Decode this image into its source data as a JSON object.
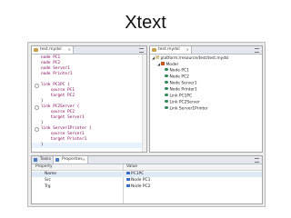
{
  "slide": {
    "title": "Xtext"
  },
  "editor": {
    "tab": "test.mydsl",
    "lines": [
      "node PC1",
      "node PC2",
      "node Server1",
      "node Printer1",
      "",
      "link PC1PC {",
      "    source PC1",
      "    target PC2",
      "}",
      "link PC2Server {",
      "    source PC2",
      "    target Server1",
      "}",
      "link Server1Printer {",
      "    source Server1",
      "    target Printer1",
      "}"
    ]
  },
  "outline": {
    "tab": "test.mydsl",
    "root": "platform:/resource/test/test.mydsl",
    "model": "Model",
    "items": [
      "Node PC1",
      "Node PC2",
      "Node Server1",
      "Node Printer1",
      "Link PC1PC",
      "Link PC2Server",
      "Link Server1Printer"
    ]
  },
  "properties": {
    "tabs": [
      "Tasks",
      "Properties"
    ],
    "columns": [
      "Property",
      "Value"
    ],
    "rows": [
      {
        "property": "Name",
        "value": "PC1PC"
      },
      {
        "property": "Src",
        "value": "Node PC1"
      },
      {
        "property": "Trg",
        "value": "Node PC2"
      }
    ]
  }
}
